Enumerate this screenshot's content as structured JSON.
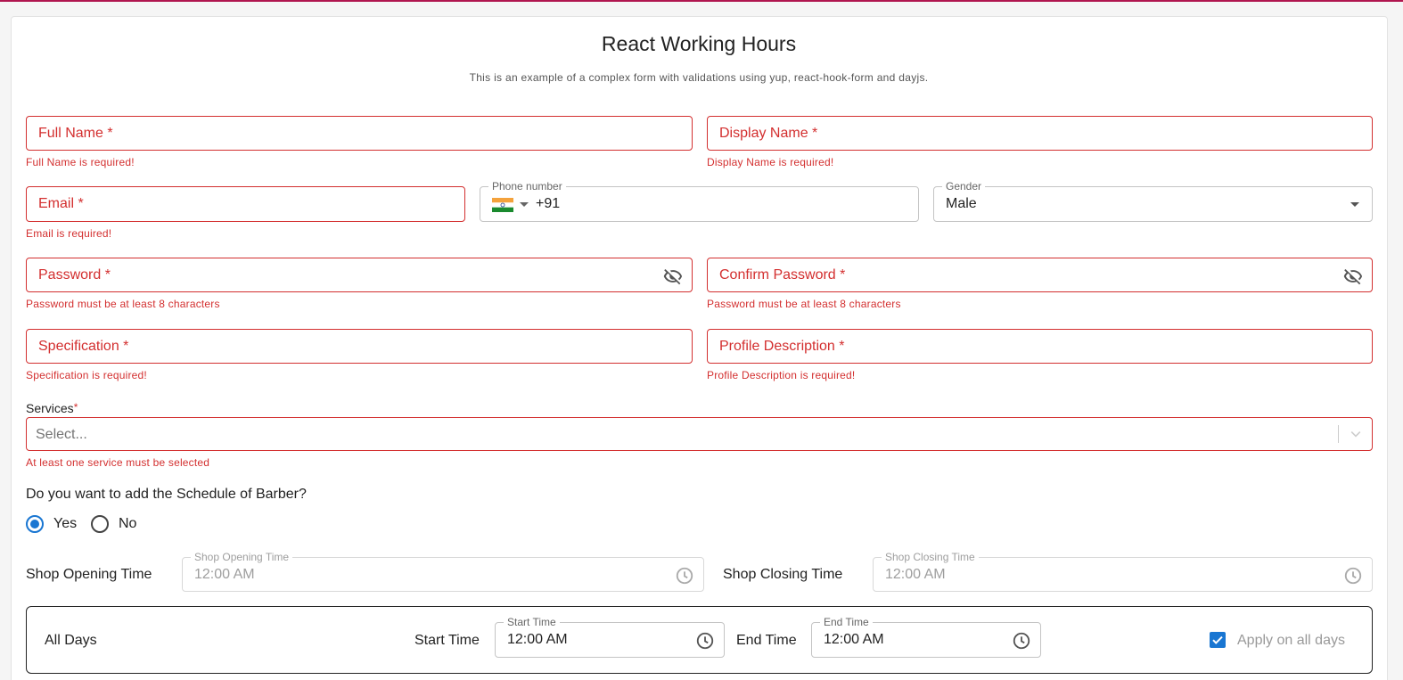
{
  "header": {
    "title": "React Working Hours",
    "subtitle": "This is an example of a complex form with validations using yup, react-hook-form and dayjs."
  },
  "fields": {
    "full_name": {
      "label": "Full Name *",
      "error": "Full Name is required!"
    },
    "display_name": {
      "label": "Display Name *",
      "error": "Display Name is required!"
    },
    "email": {
      "label": "Email *",
      "error": "Email is required!"
    },
    "phone": {
      "legend": "Phone number",
      "value": "+91",
      "flag": "india-flag-icon"
    },
    "gender": {
      "legend": "Gender",
      "value": "Male"
    },
    "password": {
      "label": "Password *",
      "error": "Password must be at least 8 characters"
    },
    "confirm_password": {
      "label": "Confirm Password *",
      "error": "Password must be at least 8 characters"
    },
    "specification": {
      "label": "Specification *",
      "error": "Specification is required!"
    },
    "profile_description": {
      "label": "Profile Description *",
      "error": "Profile Description is required!"
    }
  },
  "services": {
    "label": "Services",
    "required_mark": "*",
    "placeholder": "Select...",
    "error": "At least one service must be selected"
  },
  "schedule": {
    "question": "Do you want to add the Schedule of Barber?",
    "options": [
      {
        "label": "Yes",
        "checked": true
      },
      {
        "label": "No",
        "checked": false
      }
    ]
  },
  "shop_times": {
    "opening_label": "Shop Opening Time",
    "opening_legend": "Shop Opening Time",
    "opening_value": "12:00 AM",
    "closing_label": "Shop Closing Time",
    "closing_legend": "Shop Closing Time",
    "closing_value": "12:00 AM"
  },
  "all_days": {
    "label": "All Days",
    "start_label": "Start Time",
    "start_legend": "Start Time",
    "start_value": "12:00 AM",
    "end_label": "End Time",
    "end_legend": "End Time",
    "end_value": "12:00 AM",
    "apply_label": "Apply on all days",
    "apply_checked": true
  },
  "colors": {
    "error": "#d32f2f",
    "primary": "#1976d2",
    "accent_bar": "#b0164f"
  }
}
